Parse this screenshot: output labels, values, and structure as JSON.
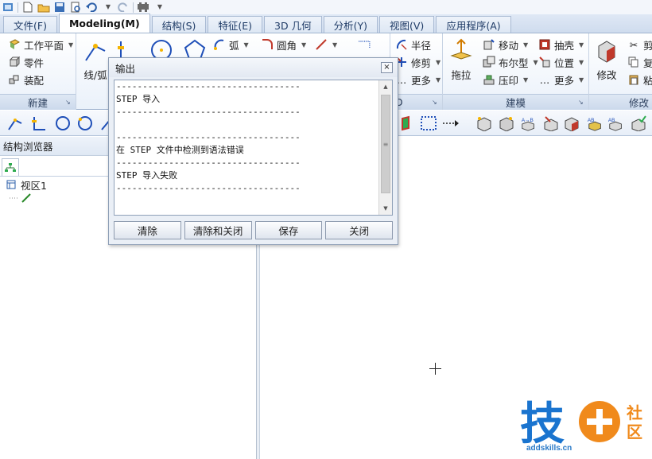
{
  "quick_access": {
    "icons": [
      "app-icon",
      "new-icon",
      "open-icon",
      "save-icon",
      "print-preview-icon",
      "undo-icon",
      "redo-icon",
      "options-icon"
    ]
  },
  "tabs": [
    {
      "label": "文件(F)",
      "active": false
    },
    {
      "label": "Modeling(M)",
      "active": true
    },
    {
      "label": "结构(S)",
      "active": false
    },
    {
      "label": "特征(E)",
      "active": false
    },
    {
      "label": "3D 几何",
      "active": false
    },
    {
      "label": "分析(Y)",
      "active": false
    },
    {
      "label": "视图(V)",
      "active": false
    },
    {
      "label": "应用程序(A)",
      "active": false
    }
  ],
  "ribbon": {
    "new_group": {
      "label": "新建",
      "items": [
        "工作平面",
        "零件",
        "装配"
      ]
    },
    "sketch_group": {
      "line_arc": "线/弧",
      "arc": "弧",
      "fillet": "圆角"
    },
    "mid_group": {
      "radius": "半径",
      "trim": "修剪",
      "more": "更多",
      "group_letter": "D"
    },
    "model_group": {
      "label": "建模",
      "drag": "拖拉",
      "move": "移动",
      "boolean": "布尔型",
      "press": "压印",
      "shell": "抽壳",
      "position": "位置",
      "more": "更多"
    },
    "modify_group": {
      "label": "修改",
      "modify": "修改",
      "cut": "剪",
      "copy": "复",
      "paste": "粘"
    }
  },
  "browser": {
    "title": "结构浏览器",
    "viewport": "视区1"
  },
  "dialog": {
    "title": "输出",
    "close_glyph": "×",
    "lines": [
      "-----------------------------------",
      "STEP 导入",
      "-----------------------------------",
      "",
      "-----------------------------------",
      "在 STEP 文件中检测到语法错误",
      "-----------------------------------",
      "STEP 导入失败",
      "-----------------------------------"
    ],
    "buttons": {
      "clear": "清除",
      "clear_close": "清除和关闭",
      "save": "保存",
      "close": "关闭"
    }
  },
  "watermark": {
    "brand": "技",
    "community_1": "社",
    "community_2": "区",
    "url": "addskills.cn"
  },
  "colors": {
    "accent_blue": "#1f6fd1",
    "watermark_orange": "#f08a1c",
    "watermark_blue": "#1a74cf"
  }
}
